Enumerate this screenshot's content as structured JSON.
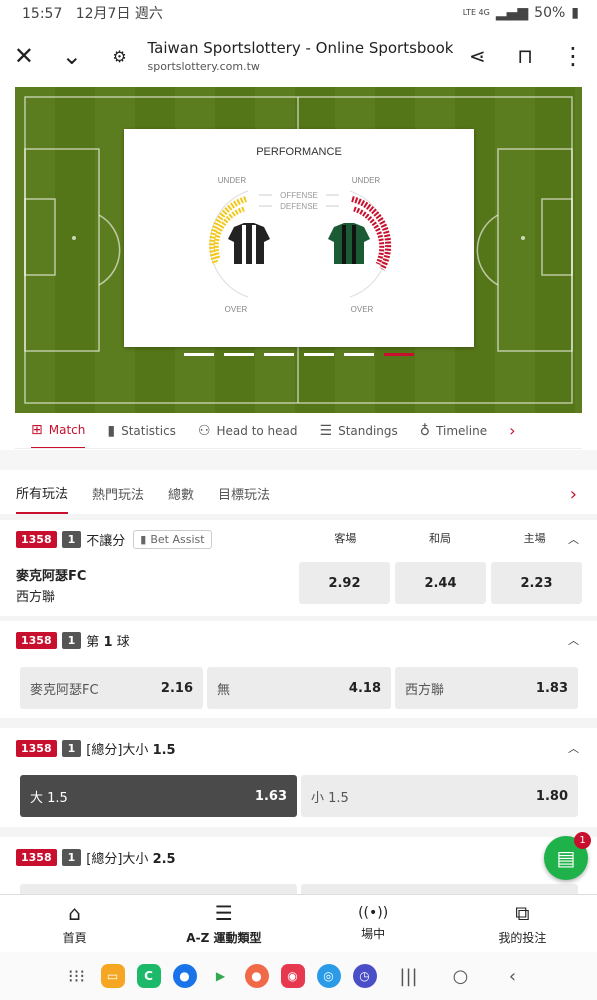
{
  "status": {
    "time": "15:57",
    "date": "12月7日 週六",
    "net": "LTE 4G",
    "battery": "50%"
  },
  "browser": {
    "title": "Taiwan Sportslottery - Online Sportsbook",
    "host": "sportslottery.com.tw"
  },
  "performance": {
    "title": "PERFORMANCE",
    "under_left": "UNDER",
    "under_right": "UNDER",
    "offense": "OFFENSE",
    "defense": "DEFENSE",
    "over_left": "OVER",
    "over_right": "OVER"
  },
  "tabs": [
    {
      "label": "Match",
      "icon": "scoreboard-icon"
    },
    {
      "label": "Statistics",
      "icon": "bar-chart-icon"
    },
    {
      "label": "Head to head",
      "icon": "users-icon"
    },
    {
      "label": "Standings",
      "icon": "list-icon"
    },
    {
      "label": "Timeline",
      "icon": "microphone-icon"
    }
  ],
  "market_tabs": [
    "所有玩法",
    "熱門玩法",
    "總數",
    "目標玩法"
  ],
  "sections": [
    {
      "code": "1358",
      "num": "1",
      "title": "不讓分",
      "bet_assist": "Bet Assist",
      "cols": [
        "客場",
        "和局",
        "主場"
      ],
      "team1": "麥克阿瑟FC",
      "team2": "西方聯",
      "odds": [
        "2.92",
        "2.44",
        "2.23"
      ]
    },
    {
      "code": "1358",
      "num": "1",
      "title": "第",
      "title_bold": "1",
      "title_end": "球",
      "options": [
        {
          "label": "麥克阿瑟FC",
          "odd": "2.16"
        },
        {
          "label": "無",
          "odd": "4.18"
        },
        {
          "label": "西方聯",
          "odd": "1.83"
        }
      ]
    },
    {
      "code": "1358",
      "num": "1",
      "title": "[總分]大小",
      "title_bold": "1.5",
      "options": [
        {
          "label": "大 1.5",
          "odd": "1.63"
        },
        {
          "label": "小 1.5",
          "odd": "1.80"
        }
      ]
    },
    {
      "code": "1358",
      "num": "1",
      "title": "[總分]大小",
      "title_bold": "2.5"
    }
  ],
  "fab_count": "1",
  "bottom_nav": [
    {
      "label": "首頁",
      "icon": "home-icon"
    },
    {
      "label": "A-Z 運動類型",
      "icon": "menu-icon"
    },
    {
      "label": "場中",
      "icon": "live-icon"
    },
    {
      "label": "我的投注",
      "icon": "bets-icon"
    }
  ]
}
